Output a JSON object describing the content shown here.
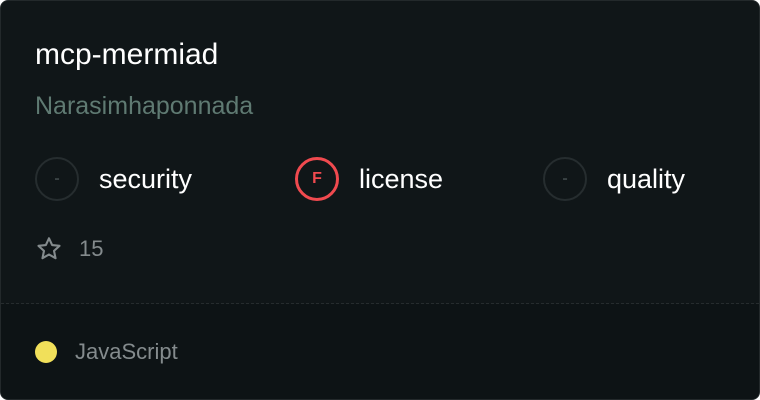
{
  "repo": {
    "name": "mcp-mermiad",
    "owner": "Narasimhaponnada"
  },
  "scores": [
    {
      "label": "security",
      "grade": "-",
      "status": "none"
    },
    {
      "label": "license",
      "grade": "F",
      "status": "fail"
    },
    {
      "label": "quality",
      "grade": "-",
      "status": "none"
    }
  ],
  "stars": {
    "icon": "star-icon",
    "count": "15"
  },
  "language": {
    "name": "JavaScript",
    "color": "#f1e05a"
  },
  "colors": {
    "background": "#101618",
    "fail": "#f04a4f"
  }
}
